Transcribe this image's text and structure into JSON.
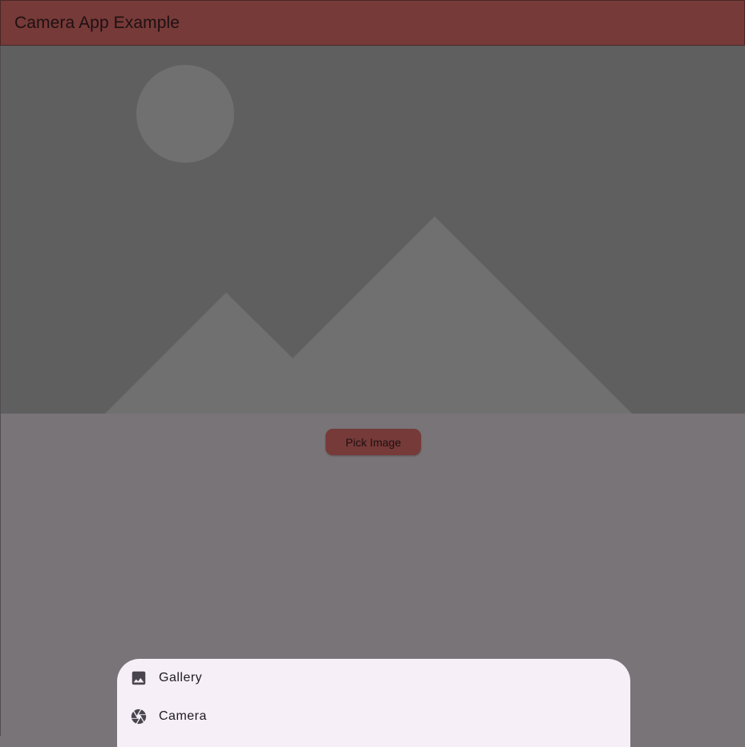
{
  "app_bar": {
    "title": "Camera App Example",
    "color": "#763a38"
  },
  "image_placeholder": {
    "icon": "image-placeholder-icon",
    "background": "#5f5f5f",
    "shape_color": "#707070"
  },
  "actions": {
    "pick_image_label": "Pick Image"
  },
  "bottom_sheet": {
    "background": "#f6eff7",
    "items": [
      {
        "label": "Gallery",
        "icon": "image-icon"
      },
      {
        "label": "Camera",
        "icon": "camera-aperture-icon"
      }
    ]
  },
  "scrim_color": "#797478"
}
